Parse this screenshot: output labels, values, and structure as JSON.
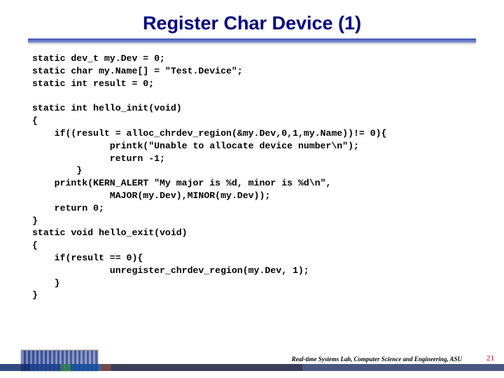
{
  "title": "Register Char Device (1)",
  "code": "static dev_t my.Dev = 0;\nstatic char my.Name[] = \"Test.Device\";\nstatic int result = 0;\n\nstatic int hello_init(void)\n{\n    if((result = alloc_chrdev_region(&my.Dev,0,1,my.Name))!= 0){\n              printk(\"Unable to allocate device number\\n\");\n              return -1;\n        }\n    printk(KERN_ALERT \"My major is %d, minor is %d\\n\",\n              MAJOR(my.Dev),MINOR(my.Dev));\n    return 0;\n}\nstatic void hello_exit(void)\n{\n    if(result == 0){\n              unregister_chrdev_region(my.Dev, 1);\n    }\n}",
  "footer_text": "Real-time Systems Lab, Computer Science and Engineering, ASU",
  "page_number": "21"
}
